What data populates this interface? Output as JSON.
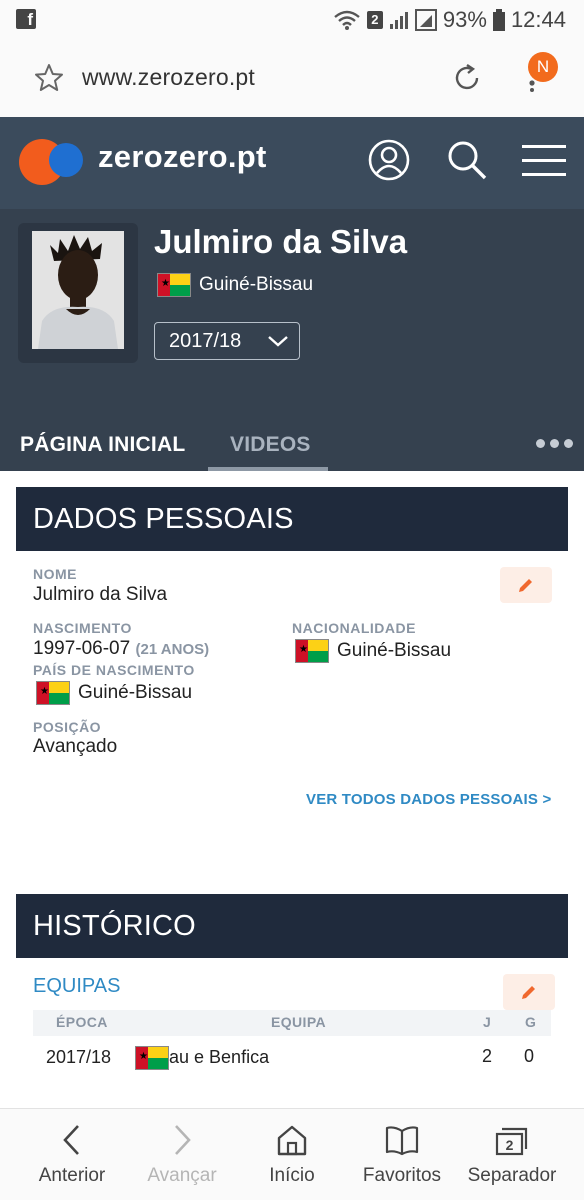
{
  "status_bar": {
    "sim_badge": "2",
    "battery": "93%",
    "time": "12:44"
  },
  "browser": {
    "url": "www.zerozero.pt",
    "notification_initial": "N"
  },
  "site": {
    "logo_text": "zerozero.pt",
    "icons": [
      "user-icon",
      "search-icon",
      "hamburger-menu-icon"
    ]
  },
  "player": {
    "name": "Julmiro da Silva",
    "nationality": "Guiné-Bissau",
    "season": "2017/18"
  },
  "tabs": [
    {
      "label": "PÁGINA INICIAL",
      "active": true
    },
    {
      "label": "VIDEOS",
      "active": false
    }
  ],
  "personal": {
    "title": "DADOS PESSOAIS",
    "name_label": "NOME",
    "name_value": "Julmiro da Silva",
    "birth_label": "NASCIMENTO",
    "birth_value": "1997-06-07",
    "age_value": "(21 ANOS)",
    "nationality_label": "NACIONALIDADE",
    "nationality_value": "Guiné-Bissau",
    "birth_country_label": "PAÍS DE NASCIMENTO",
    "birth_country_value": "Guiné-Bissau",
    "position_label": "POSIÇÃO",
    "position_value": "Avançado",
    "see_all": "VER TODOS DADOS PESSOAIS >"
  },
  "history": {
    "title": "HISTÓRICO",
    "teams_link": "EQUIPAS",
    "columns": [
      "ÉPOCA",
      "EQUIPA",
      "J",
      "G"
    ],
    "rows": [
      {
        "season": "2017/18",
        "team": "Bissau e Benfica",
        "games": "2",
        "goals": "0"
      }
    ]
  },
  "bottom_bar": [
    {
      "label": "Anterior",
      "icon": "back-icon",
      "enabled": true
    },
    {
      "label": "Avançar",
      "icon": "forward-icon",
      "enabled": false
    },
    {
      "label": "Início",
      "icon": "home-icon",
      "enabled": true
    },
    {
      "label": "Favoritos",
      "icon": "bookmarks-icon",
      "enabled": true
    },
    {
      "label": "Separador",
      "icon": "tabs-icon",
      "enabled": true,
      "count": "2"
    }
  ],
  "colors": {
    "header_bg": "#3b4b5c",
    "profile_bg": "#35414f",
    "section_bar": "#1f2a3c",
    "link": "#2f8ac4",
    "logo_orange": "#f25c1d",
    "logo_blue": "#1f6fd1"
  }
}
